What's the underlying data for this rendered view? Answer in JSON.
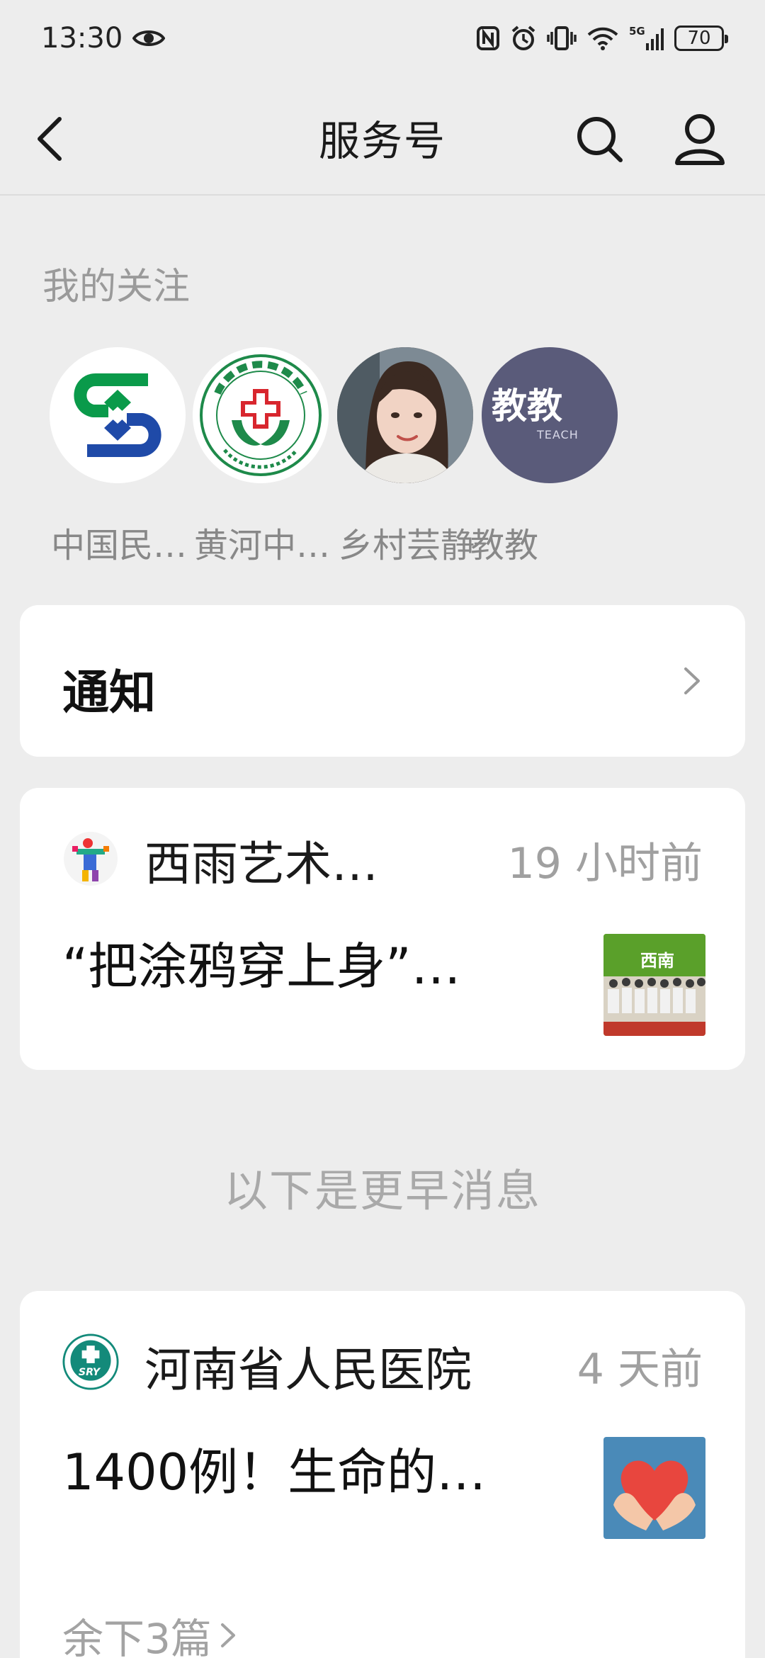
{
  "status_bar": {
    "time": "13:30",
    "battery": "70",
    "network": "5G",
    "icons": [
      "eye-icon",
      "nfc-icon",
      "alarm-icon",
      "vibrate-icon",
      "wifi-icon",
      "signal-icon",
      "battery-icon"
    ]
  },
  "nav": {
    "title": "服务号",
    "icons": [
      "back-icon",
      "search-icon",
      "profile-icon"
    ]
  },
  "follows": {
    "label": "我的关注",
    "items": [
      {
        "name": "中国民…",
        "avatar": "bank-logo"
      },
      {
        "name": "黄河中…",
        "avatar": "hospital-logo"
      },
      {
        "name": "乡村芸静",
        "avatar": "person-photo"
      },
      {
        "name": "教教",
        "avatar": "education-logo",
        "avatar_text": "教教",
        "avatar_subtext": "TEACH"
      }
    ]
  },
  "notice": {
    "title": "通知"
  },
  "messages": [
    {
      "sender": "西雨艺术…",
      "time": "19 小时前",
      "title": "“把涂鸦穿上身”…",
      "thumb_text": "西南"
    }
  ],
  "earlier_label": "以下是更早消息",
  "earlier_messages": [
    {
      "sender": "河南省人民医院",
      "sender_icon_text": "SRY",
      "time": "4 天前",
      "title": "1400例！生命的…",
      "more": "余下3篇"
    }
  ],
  "colors": {
    "background": "#ededed",
    "card": "#ffffff",
    "bank_green": "#0a9a4a",
    "bank_blue": "#1f4aa8",
    "hospital_green": "#1e8a4a",
    "hospital_red": "#d8262e",
    "heart_red": "#e8463e",
    "thumb_blue": "#4a8ab8"
  }
}
